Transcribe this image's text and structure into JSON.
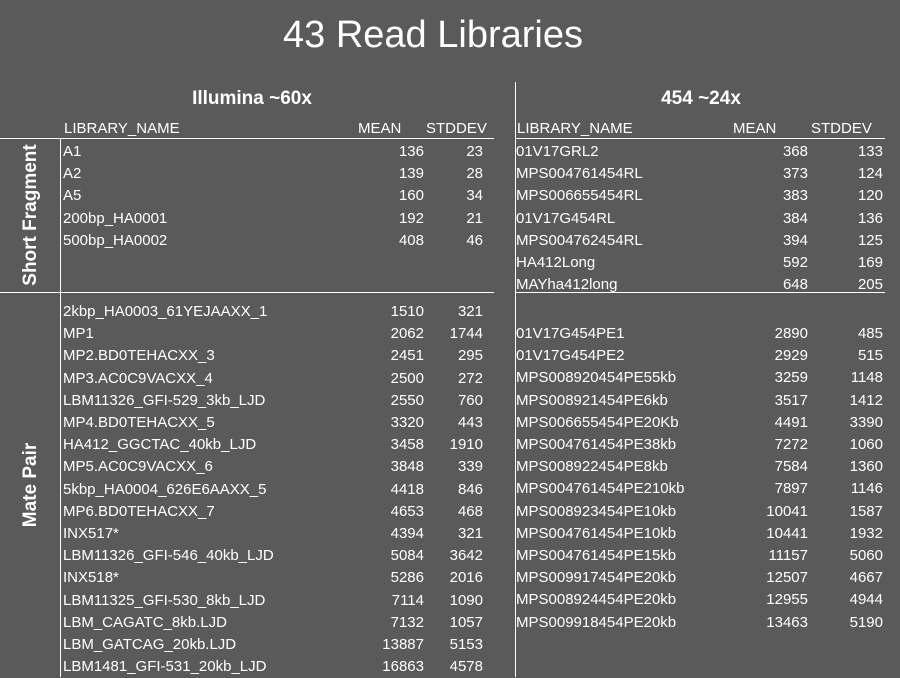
{
  "title": "43 Read Libraries",
  "groups": {
    "illumina": "Illumina ~60x",
    "f454": "454 ~24x"
  },
  "columns": {
    "name": "LIBRARY_NAME",
    "mean": "MEAN",
    "stddev": "STDDEV"
  },
  "sections": {
    "short": "Short Fragment",
    "mate": "Mate Pair"
  },
  "illumina_short": [
    {
      "name": "A1",
      "mean": "136",
      "stddev": "23"
    },
    {
      "name": "A2",
      "mean": "139",
      "stddev": "28"
    },
    {
      "name": "A5",
      "mean": "160",
      "stddev": "34"
    },
    {
      "name": "200bp_HA0001",
      "mean": "192",
      "stddev": "21"
    },
    {
      "name": "500bp_HA0002",
      "mean": "408",
      "stddev": "46"
    }
  ],
  "f454_short": [
    {
      "name": "01V17GRL2",
      "mean": "368",
      "stddev": "133"
    },
    {
      "name": "MPS004761454RL",
      "mean": "373",
      "stddev": "124"
    },
    {
      "name": "MPS006655454RL",
      "mean": "383",
      "stddev": "120"
    },
    {
      "name": "01V17G454RL",
      "mean": "384",
      "stddev": "136"
    },
    {
      "name": "MPS004762454RL",
      "mean": "394",
      "stddev": "125"
    },
    {
      "name": "HA412Long",
      "mean": "592",
      "stddev": "169"
    },
    {
      "name": "MAYha412long",
      "mean": "648",
      "stddev": "205"
    }
  ],
  "illumina_mate": [
    {
      "name": "2kbp_HA0003_61YEJAAXX_1",
      "mean": "1510",
      "stddev": "321"
    },
    {
      "name": "MP1",
      "mean": "2062",
      "stddev": "1744"
    },
    {
      "name": "MP2.BD0TEHACXX_3",
      "mean": "2451",
      "stddev": "295"
    },
    {
      "name": "MP3.AC0C9VACXX_4",
      "mean": "2500",
      "stddev": "272"
    },
    {
      "name": "LBM11326_GFI-529_3kb_LJD",
      "mean": "2550",
      "stddev": "760"
    },
    {
      "name": "MP4.BD0TEHACXX_5",
      "mean": "3320",
      "stddev": "443"
    },
    {
      "name": "HA412_GGCTAC_40kb_LJD",
      "mean": "3458",
      "stddev": "1910"
    },
    {
      "name": "MP5.AC0C9VACXX_6",
      "mean": "3848",
      "stddev": "339"
    },
    {
      "name": "5kbp_HA0004_626E6AAXX_5",
      "mean": "4418",
      "stddev": "846"
    },
    {
      "name": "MP6.BD0TEHACXX_7",
      "mean": "4653",
      "stddev": "468"
    },
    {
      "name": "INX517*",
      "mean": "4394",
      "stddev": "321"
    },
    {
      "name": "LBM11326_GFI-546_40kb_LJD",
      "mean": "5084",
      "stddev": "3642"
    },
    {
      "name": "INX518*",
      "mean": "5286",
      "stddev": "2016"
    },
    {
      "name": "LBM11325_GFI-530_8kb_LJD",
      "mean": "7114",
      "stddev": "1090"
    },
    {
      "name": "LBM_CAGATC_8kb.LJD",
      "mean": "7132",
      "stddev": "1057"
    },
    {
      "name": "LBM_GATCAG_20kb.LJD",
      "mean": "13887",
      "stddev": "5153"
    },
    {
      "name": "LBM1481_GFI-531_20kb_LJD",
      "mean": "16863",
      "stddev": "4578"
    }
  ],
  "f454_mate": [
    {
      "name": "01V17G454PE1",
      "mean": "2890",
      "stddev": "485"
    },
    {
      "name": "01V17G454PE2",
      "mean": "2929",
      "stddev": "515"
    },
    {
      "name": "MPS008920454PE55kb",
      "mean": "3259",
      "stddev": "1148"
    },
    {
      "name": "MPS008921454PE6kb",
      "mean": "3517",
      "stddev": "1412"
    },
    {
      "name": "MPS006655454PE20Kb",
      "mean": "4491",
      "stddev": "3390"
    },
    {
      "name": "MPS004761454PE38kb",
      "mean": "7272",
      "stddev": "1060"
    },
    {
      "name": "MPS008922454PE8kb",
      "mean": "7584",
      "stddev": "1360"
    },
    {
      "name": "MPS004761454PE210kb",
      "mean": "7897",
      "stddev": "1146"
    },
    {
      "name": "MPS008923454PE10kb",
      "mean": "10041",
      "stddev": "1587"
    },
    {
      "name": "MPS004761454PE10kb",
      "mean": "10441",
      "stddev": "1932"
    },
    {
      "name": "MPS004761454PE15kb",
      "mean": "11157",
      "stddev": "5060"
    },
    {
      "name": "MPS009917454PE20kb",
      "mean": "12507",
      "stddev": "4667"
    },
    {
      "name": "MPS008924454PE20kb",
      "mean": "12955",
      "stddev": "4944"
    },
    {
      "name": "MPS009918454PE20kb",
      "mean": "13463",
      "stddev": "5190"
    }
  ]
}
